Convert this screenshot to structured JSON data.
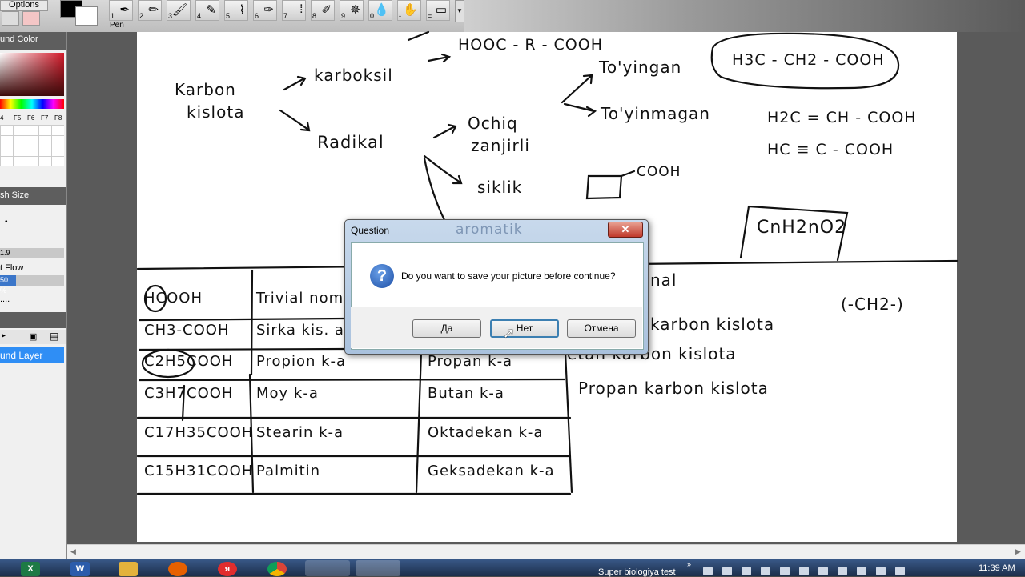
{
  "toolbar": {
    "options_label": "Options",
    "pen_label": "Pen",
    "tools": [
      {
        "num": "1",
        "icon": "pen-icon"
      },
      {
        "num": "2",
        "icon": "pencil-icon"
      },
      {
        "num": "3",
        "icon": "brush-icon"
      },
      {
        "num": "4",
        "icon": "marker-icon"
      },
      {
        "num": "5",
        "icon": "airbrush-icon"
      },
      {
        "num": "6",
        "icon": "fountain-pen-icon"
      },
      {
        "num": "7",
        "icon": "paint-brush-icon"
      },
      {
        "num": "8",
        "icon": "crayon-icon"
      },
      {
        "num": "9",
        "icon": "smudge-icon"
      },
      {
        "num": "0",
        "icon": "water-drop-icon"
      },
      {
        "num": "-",
        "icon": "hand-icon"
      },
      {
        "num": "=",
        "icon": "eraser-icon"
      }
    ]
  },
  "left_panel": {
    "color_title": "und Color",
    "palette_keys": [
      "4",
      "F5",
      "F6",
      "F7",
      "F8"
    ],
    "brush_size_title": "sh Size",
    "brush_size_value": "1.9",
    "flow_title": "t Flow",
    "flow_value": "50 %",
    "more": "....",
    "layer_name": "und Layer"
  },
  "canvas": {
    "left": [
      "Karbon",
      "kislota"
    ],
    "karboksil": "karboksil",
    "hooc": "HOOC - R - COOH",
    "radikal": "Radikal",
    "toyingan": "To'yingan",
    "toyinmagan": "To'yinmagan",
    "boxed1": "H3C - CH2 - COOH",
    "unsat1": "H2C = CH - COOH",
    "unsat2": "HC ≡ C - COOH",
    "ochiq": "Ochiq",
    "zanjirli": "zanjirli",
    "siklik": "siklik",
    "cooh": "COOH",
    "aromatik": "aromatik",
    "formula": "CnH2nO2",
    "ch2": "(-CH2-)",
    "nal": "nal",
    "table": [
      [
        "HCOOH",
        "Trivial nomli",
        ""
      ],
      [
        "CH3-COOH",
        "Sirka kis. asetat",
        ""
      ],
      [
        "C2H5COOH",
        "Propion k-a",
        "Propan k-a"
      ],
      [
        "C3H7COOH",
        "Moy k-a",
        "Butan k-a"
      ],
      [
        "C17H35COOH",
        "Stearin k-a",
        "Oktadekan k-a"
      ],
      [
        "C15H31COOH",
        "Palmitin",
        "Geksadekan k-a"
      ]
    ],
    "right_lines": [
      "karbon kislota",
      "etan karbon kislota",
      "Propan karbon kislota"
    ]
  },
  "dialog": {
    "title": "Question",
    "close": "✕",
    "message": "Do you want to save your picture before continue?",
    "yes": "Да",
    "no": "Нет",
    "cancel": "Отмена"
  },
  "taskbar": {
    "window_title": "Super biologiya test",
    "clock": "11:39 AM"
  }
}
